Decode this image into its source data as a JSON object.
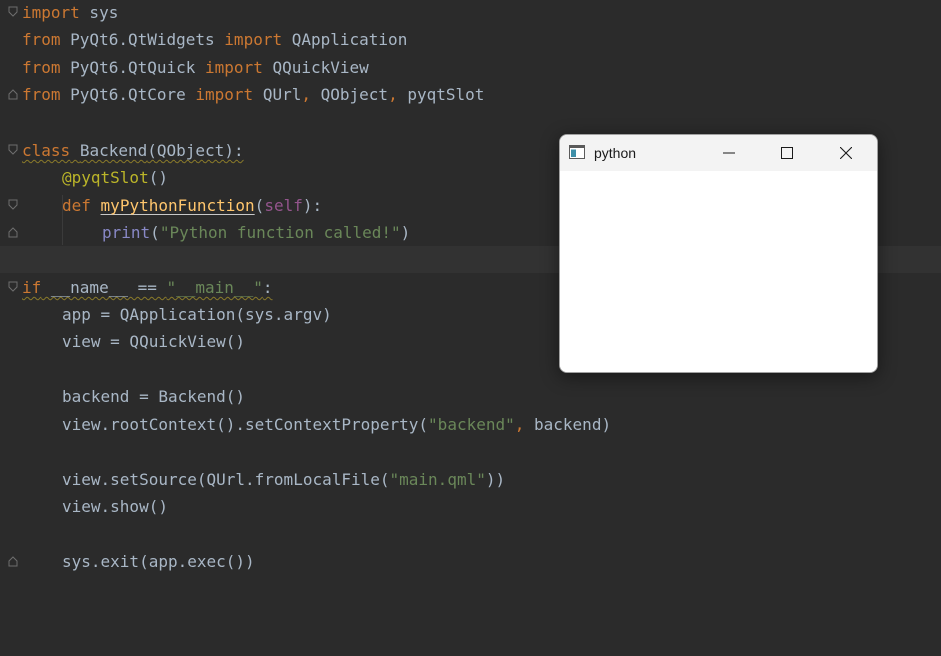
{
  "editor": {
    "lines": {
      "l1": {
        "a": "import",
        "b": " sys"
      },
      "l2": {
        "a": "from",
        "b": " PyQt6.QtWidgets ",
        "c": "import",
        "d": " QApplication"
      },
      "l3": {
        "a": "from",
        "b": " PyQt6.QtQuick ",
        "c": "import",
        "d": " QQuickView"
      },
      "l4": {
        "a": "from",
        "b": " PyQt6.QtCore ",
        "c": "import",
        "d": " QUrl",
        "e": ", ",
        "f": "QObject",
        "g": ", ",
        "h": "pyqtSlot"
      },
      "l6": {
        "a": "class",
        "b": " ",
        "c": "Backend",
        "d": "(QObject):"
      },
      "l7": {
        "a": "@pyqtSlot",
        "b": "()"
      },
      "l8": {
        "a": "def",
        "b": " ",
        "c": "myPythonFunction",
        "d": "(",
        "e": "self",
        "f": "):"
      },
      "l9": {
        "a": "print",
        "b": "(",
        "c": "\"Python function called!\"",
        "d": ")"
      },
      "l11": {
        "a": "if",
        "b": " __name__ == ",
        "c": "\"__main__\"",
        "d": ":"
      },
      "l12": {
        "a": "app = QApplication(sys.argv)"
      },
      "l13": {
        "a": "view = QQuickView()"
      },
      "l15": {
        "a": "backend = Backend()"
      },
      "l16": {
        "a": "view.rootContext().setContextProperty(",
        "b": "\"backend\"",
        "c": ", ",
        "d": "backend)"
      },
      "l18": {
        "a": "view.setSource(QUrl.fromLocalFile(",
        "b": "\"main.qml\"",
        "c": "))"
      },
      "l19": {
        "a": "view.show()"
      },
      "l21": {
        "a": "sys.exit(app.exec())"
      }
    }
  },
  "window": {
    "title": "python"
  },
  "colors": {
    "editor_bg": "#2b2b2b",
    "keyword": "#cc7832",
    "string": "#6a8759",
    "function": "#ffc66d",
    "decorator": "#bbb529",
    "self": "#94558d",
    "builtin": "#8888c6",
    "default": "#a9b7c6"
  }
}
